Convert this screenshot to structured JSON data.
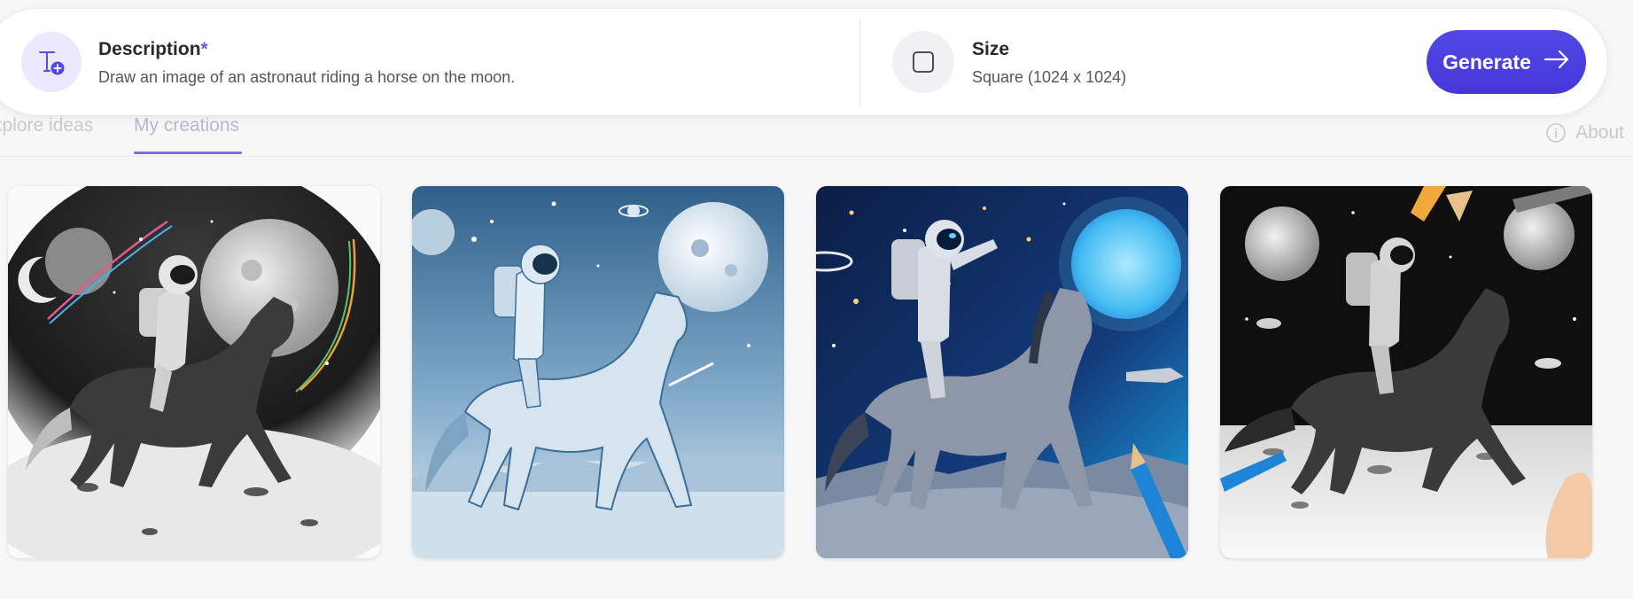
{
  "prompt": {
    "description_label": "Description",
    "required_mark": "*",
    "description_value": "Draw an image of an astronaut riding a horse on the moon.",
    "size_label": "Size",
    "size_value": "Square (1024 x 1024)",
    "generate_label": "Generate"
  },
  "tabs": [
    {
      "label": "xplore ideas",
      "active": false
    },
    {
      "label": "My creations",
      "active": true
    }
  ],
  "about_label": "About",
  "colors": {
    "accent": "#4f46e5",
    "tab_underline": "#7b6fe0",
    "icon_bg": "#ece8fd"
  },
  "images": [
    {
      "style": "sepia-sketch",
      "icon": "image-thumbnail"
    },
    {
      "style": "blue-sketch",
      "icon": "image-thumbnail"
    },
    {
      "style": "starry-blue",
      "icon": "image-thumbnail"
    },
    {
      "style": "pencil-drawing",
      "icon": "image-thumbnail"
    }
  ]
}
